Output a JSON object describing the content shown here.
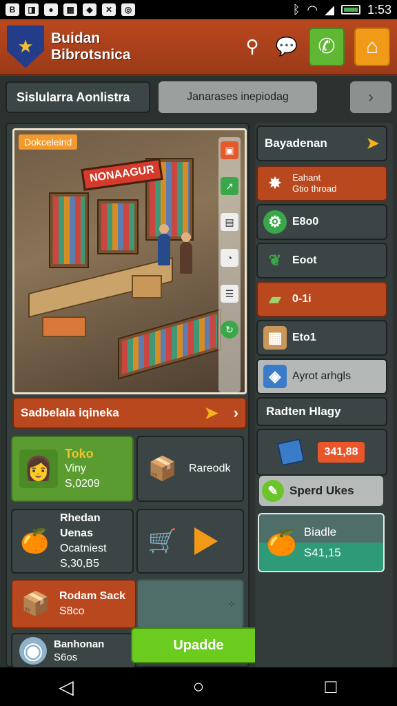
{
  "status_bar": {
    "time": "1:53",
    "left_icons": [
      "notification-icon-1",
      "notification-icon-2",
      "notification-icon-3",
      "notification-icon-4",
      "notification-icon-5",
      "notification-icon-6",
      "notification-icon-7"
    ]
  },
  "header": {
    "brand_line1": "Buidan",
    "brand_line2": "Bibrotsnica",
    "actions": [
      "search-icon",
      "chat-icon",
      "phone-icon",
      "shop-icon"
    ]
  },
  "tabs": {
    "active": "Sislularra Aonlistra",
    "secondary": "Janarases inepiodag"
  },
  "scene": {
    "badge": "Dokceleind",
    "shop_sign": "NONAAGUR"
  },
  "banner": {
    "label": "Sadbelala iqineka"
  },
  "cards": [
    {
      "title": "Toko",
      "line2": "Viny",
      "line3": "S,0209"
    },
    {
      "title": "Rareodk"
    },
    {
      "title": "Rhedan Uenas",
      "line2": "Ocatniest",
      "line3": "S,30,B5"
    },
    {
      "title": "Rodam Sack",
      "line2": "S8co"
    },
    {
      "title": "Banhonan",
      "line2": "S6os"
    }
  ],
  "update_button": "Upadde",
  "right_panel": {
    "header": "Bayadenan",
    "items": [
      {
        "label_line1": "Eahant",
        "label_line2": "Gtio throad"
      },
      {
        "label": "E8o0"
      },
      {
        "label": "Eoot"
      },
      {
        "label": "0-1i"
      },
      {
        "label": "Eto1"
      },
      {
        "label": "Ayrot arhgls"
      }
    ],
    "sub_header": "Radten Hlagy",
    "price": "341,88",
    "speed_button": "Sperd Ukes",
    "blade": {
      "title": "Biadle",
      "price": "S41,15"
    }
  }
}
